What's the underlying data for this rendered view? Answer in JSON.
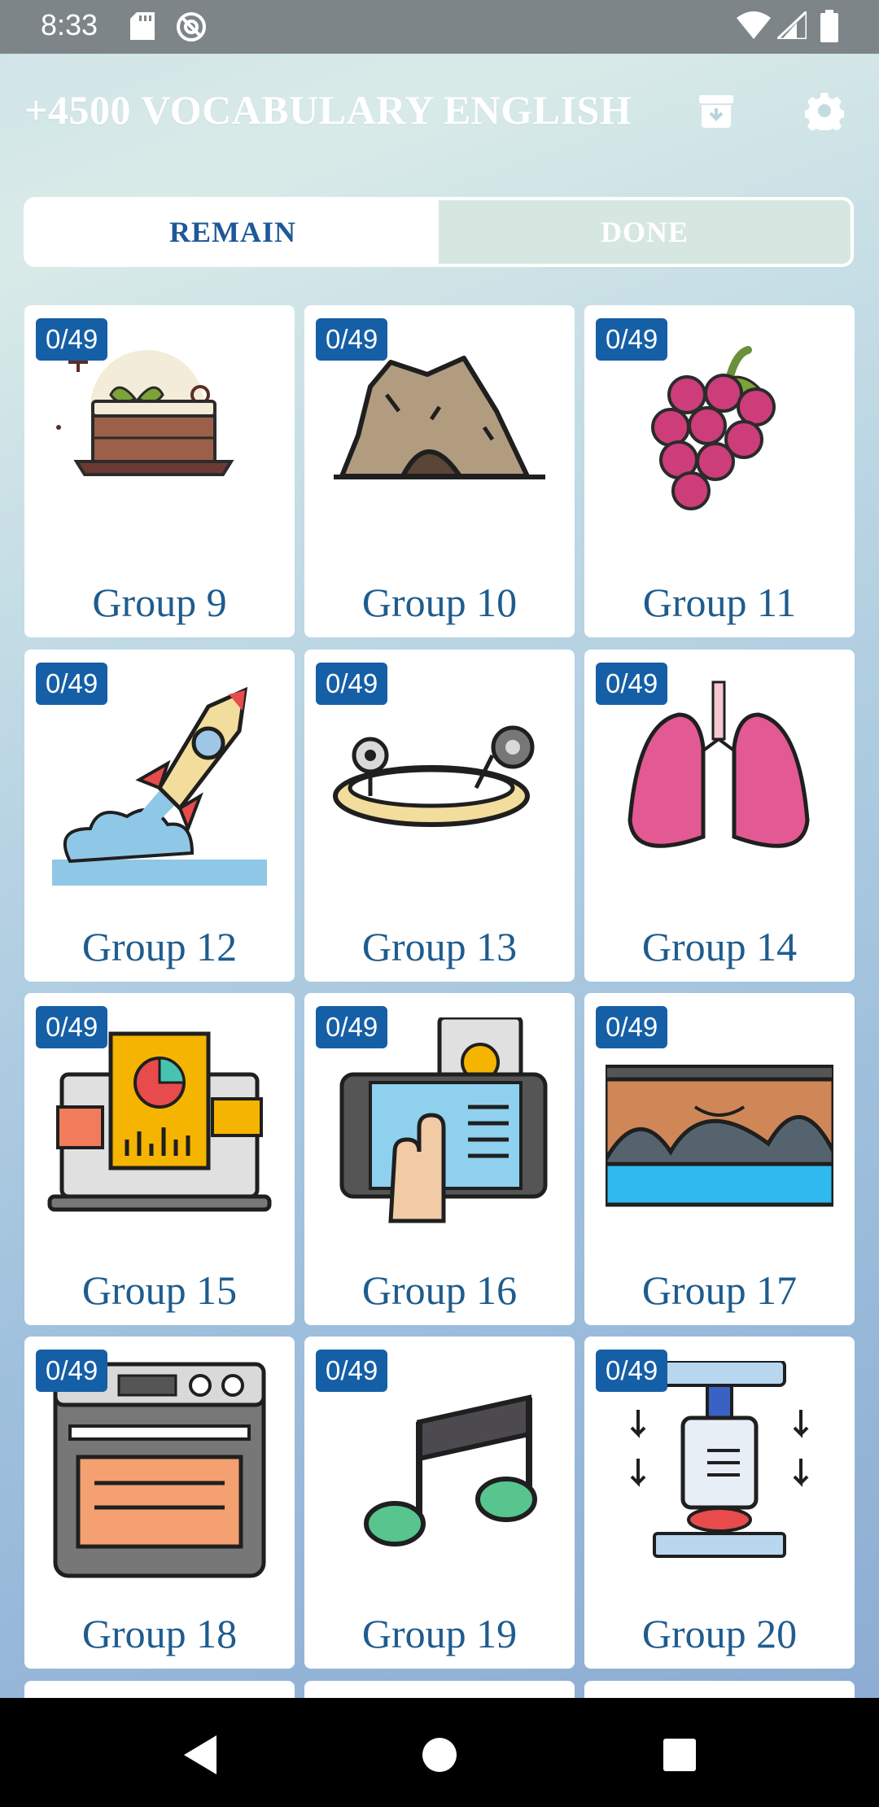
{
  "status_bar": {
    "time": "8:33"
  },
  "app_bar": {
    "title": "+4500 VOCABULARY ENGLISH",
    "icons": [
      "archive-download-icon",
      "gear-icon"
    ]
  },
  "tabs": [
    {
      "label": "REMAIN",
      "active": true
    },
    {
      "label": "DONE",
      "active": false
    }
  ],
  "groups": [
    {
      "label": "Group 9",
      "progress": "0/49",
      "icon": "cake-icon"
    },
    {
      "label": "Group 10",
      "progress": "0/49",
      "icon": "cave-icon"
    },
    {
      "label": "Group 11",
      "progress": "0/49",
      "icon": "grapes-icon"
    },
    {
      "label": "Group 12",
      "progress": "0/49",
      "icon": "rocket-icon"
    },
    {
      "label": "Group 13",
      "progress": "0/49",
      "icon": "bracelet-icon"
    },
    {
      "label": "Group 14",
      "progress": "0/49",
      "icon": "lungs-icon"
    },
    {
      "label": "Group 15",
      "progress": "0/49",
      "icon": "analytics-laptop-icon"
    },
    {
      "label": "Group 16",
      "progress": "0/49",
      "icon": "touch-screen-icon"
    },
    {
      "label": "Group 17",
      "progress": "0/49",
      "icon": "bridge-icon"
    },
    {
      "label": "Group 18",
      "progress": "0/49",
      "icon": "oven-icon"
    },
    {
      "label": "Group 19",
      "progress": "0/49",
      "icon": "music-note-icon"
    },
    {
      "label": "Group 20",
      "progress": "0/49",
      "icon": "press-machine-icon"
    }
  ],
  "colors": {
    "accent": "#155fa6",
    "label": "#1f5c8e",
    "tab_inactive_bg": "#d6e7e1"
  }
}
